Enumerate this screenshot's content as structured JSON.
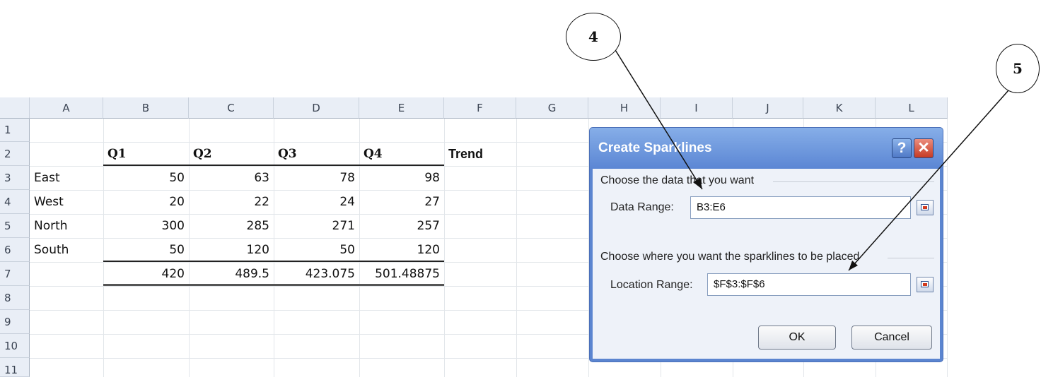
{
  "spreadsheet": {
    "columns": [
      "A",
      "B",
      "C",
      "D",
      "E",
      "F",
      "G",
      "H",
      "I",
      "J",
      "K",
      "L"
    ],
    "rows": [
      "1",
      "2",
      "3",
      "4",
      "5",
      "6",
      "7",
      "8",
      "9",
      "10",
      "11"
    ],
    "headers": {
      "B": "Q1",
      "C": "Q2",
      "D": "Q3",
      "E": "Q4",
      "F": "Trend"
    },
    "data": [
      {
        "label": "East",
        "values": [
          "50",
          "63",
          "78",
          "98"
        ]
      },
      {
        "label": "West",
        "values": [
          "20",
          "22",
          "24",
          "27"
        ]
      },
      {
        "label": "North",
        "values": [
          "300",
          "285",
          "271",
          "257"
        ]
      },
      {
        "label": "South",
        "values": [
          "50",
          "120",
          "50",
          "120"
        ]
      }
    ],
    "totals": [
      "420",
      "489.5",
      "423.075",
      "501.48875"
    ]
  },
  "dialog": {
    "title": "Create Sparklines",
    "help_label": "?",
    "close_label": "✕",
    "section_data": "Choose the data that you want",
    "data_range_label": "Data Range:",
    "data_range_value": "B3:E6",
    "section_location": "Choose where you want the sparklines to be placed",
    "location_range_label": "Location Range:",
    "location_range_value": "$F$3:$F$6",
    "ok_label": "OK",
    "cancel_label": "Cancel"
  },
  "callouts": [
    {
      "number": "4",
      "points_to": "data-range-input"
    },
    {
      "number": "5",
      "points_to": "location-range-input"
    }
  ],
  "colors": {
    "titlebar": "#5b86d4",
    "close": "#c63b24",
    "header_bg": "#e9eef6"
  },
  "icons": [
    "collapse-dialog-icon",
    "help-icon",
    "close-icon"
  ]
}
